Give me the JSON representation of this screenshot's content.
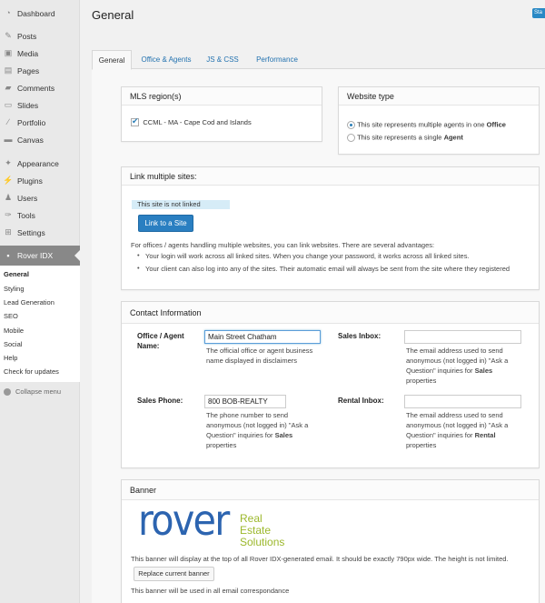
{
  "sidebar": {
    "items": [
      {
        "label": "Dashboard",
        "icon": "dashboard-icon",
        "glyph": "◔"
      },
      {
        "label": "Posts",
        "icon": "pin-icon",
        "glyph": "✎"
      },
      {
        "label": "Media",
        "icon": "media-icon",
        "glyph": "▣"
      },
      {
        "label": "Pages",
        "icon": "pages-icon",
        "glyph": "▤"
      },
      {
        "label": "Comments",
        "icon": "comments-icon",
        "glyph": "▰"
      },
      {
        "label": "Slides",
        "icon": "slides-icon",
        "glyph": "▭"
      },
      {
        "label": "Portfolio",
        "icon": "portfolio-icon",
        "glyph": "∕"
      },
      {
        "label": "Canvas",
        "icon": "canvas-icon",
        "glyph": "▬"
      },
      {
        "label": "Appearance",
        "icon": "appearance-icon",
        "glyph": "✦"
      },
      {
        "label": "Plugins",
        "icon": "plugins-icon",
        "glyph": "⚡"
      },
      {
        "label": "Users",
        "icon": "users-icon",
        "glyph": "♟"
      },
      {
        "label": "Tools",
        "icon": "tools-icon",
        "glyph": "✑"
      },
      {
        "label": "Settings",
        "icon": "settings-icon",
        "glyph": "⊞"
      },
      {
        "label": "Rover IDX",
        "icon": "rover-icon",
        "glyph": "▪"
      }
    ],
    "submenu": [
      "General",
      "Styling",
      "Lead Generation",
      "SEO",
      "Mobile",
      "Social",
      "Help",
      "Check for updates"
    ],
    "collapse_label": "Collapse menu"
  },
  "page": {
    "title": "General",
    "top_button": "Sta"
  },
  "tabs": [
    "General",
    "Office & Agents",
    "JS & CSS",
    "Performance"
  ],
  "mls": {
    "title": "MLS region(s)",
    "option": "CCML - MA - Cape Cod and Islands"
  },
  "website_type": {
    "title": "Website type",
    "option1_prefix": "This site represents multiple agents in one ",
    "option1_bold": "Office",
    "option2_prefix": "This site represents a single ",
    "option2_bold": "Agent"
  },
  "link_sites": {
    "title": "Link multiple sites:",
    "status": "This site is not linked",
    "button": "Link to a Site",
    "intro": "For offices / agents handling multiple websites, you can link websites. There are several advantages:",
    "bullet1": "Your login will work across all linked sites. When you change your password, it works across all linked sites.",
    "bullet2": "Your client can also log into any of the sites. Their automatic email will always be sent from the site where they registered"
  },
  "contact": {
    "title": "Contact Information",
    "office_label_1": "Office / Agent",
    "office_label_2": "Name:",
    "office_value": "Main Street Chatham",
    "office_help_1": "The official office or agent business",
    "office_help_2": "name displayed in disclaimers",
    "sales_inbox_label": "Sales Inbox:",
    "sales_inbox_value": "",
    "sales_inbox_help_1": "The email address used to send",
    "sales_inbox_help_2": "anonymous (not logged in) \"Ask a",
    "sales_inbox_help_3a": "Question\" inquiries for ",
    "sales_inbox_help_3b": "Sales",
    "sales_inbox_help_4": "properties",
    "sales_phone_label": "Sales Phone:",
    "sales_phone_value": "800 BOB-REALTY",
    "sales_phone_help_1": "The phone number to send",
    "sales_phone_help_2": "anonymous (not logged in) \"Ask a",
    "sales_phone_help_3a": "Question\" inquiries for ",
    "sales_phone_help_3b": "Sales",
    "sales_phone_help_4": "properties",
    "rental_inbox_label": "Rental Inbox:",
    "rental_inbox_value": "",
    "rental_inbox_help_1": "The email address used to send",
    "rental_inbox_help_2": "anonymous (not logged in) \"Ask a",
    "rental_inbox_help_3a": "Question\" inquiries for ",
    "rental_inbox_help_3b": "Rental",
    "rental_inbox_help_4": "properties"
  },
  "banner": {
    "title": "Banner",
    "logo_word": "rover",
    "logo_line1": "Real",
    "logo_line2": "Estate",
    "logo_line3": "Solutions",
    "note": "This banner will display at the top of all Rover IDX-generated email. It should be exactly 790px wide. The height is not limited.",
    "button": "Replace current banner",
    "footer": "This banner will be used in all email correspondance"
  },
  "colors": {
    "accent": "#2a7fc1",
    "logo_blue": "#2c64b0",
    "logo_green": "#9cb82c"
  }
}
